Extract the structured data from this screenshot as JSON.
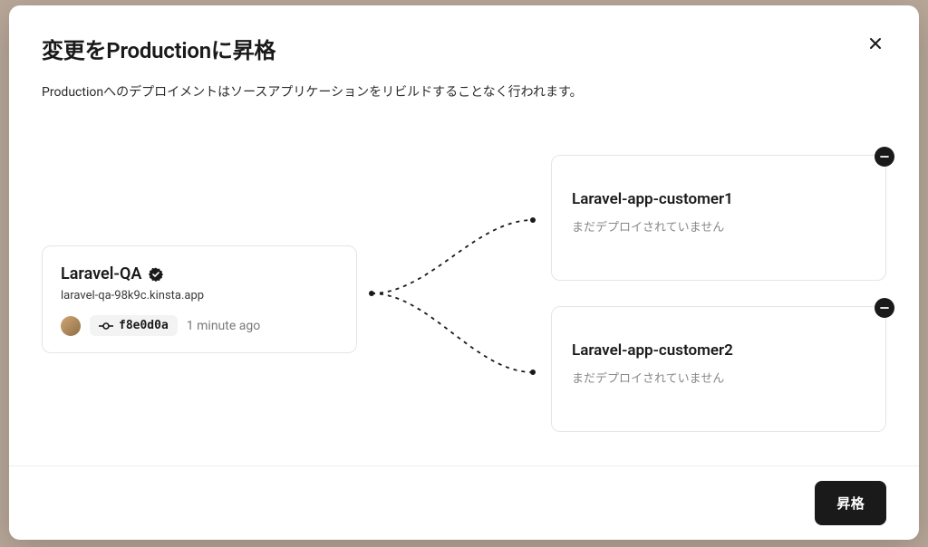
{
  "modal": {
    "title": "変更をProductionに昇格",
    "description": "Productionへのデプロイメントはソースアプリケーションをリビルドすることなく行われます。"
  },
  "source": {
    "name": "Laravel-QA",
    "url": "laravel-qa-98k9c.kinsta.app",
    "commit": "f8e0d0a",
    "time": "1 minute ago"
  },
  "targets": [
    {
      "name": "Laravel-app-customer1",
      "status": "まだデプロイされていません"
    },
    {
      "name": "Laravel-app-customer2",
      "status": "まだデプロイされていません"
    }
  ],
  "footer": {
    "promote_label": "昇格"
  }
}
